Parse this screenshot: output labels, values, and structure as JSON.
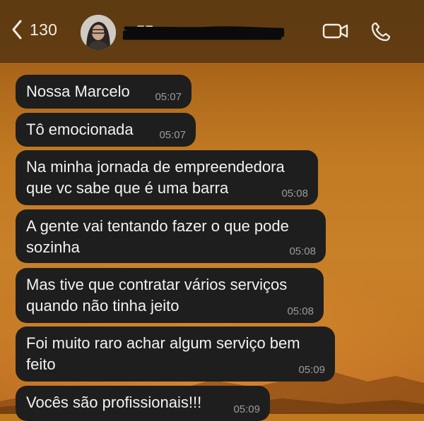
{
  "header": {
    "back_count": "130",
    "contact_name": "+55",
    "icons": {
      "back": "chevron-left-icon",
      "video": "video-camera-icon",
      "call": "phone-icon"
    }
  },
  "messages": [
    {
      "text": "Nossa Marcelo",
      "time": "05:07"
    },
    {
      "text": "Tô emocionada",
      "time": "05:07"
    },
    {
      "text": "Na minha jornada de empreendedora\nque vc sabe que é uma barra",
      "time": "05:08"
    },
    {
      "text": "A gente vai tentando fazer o que pode\nsozinha",
      "time": "05:08"
    },
    {
      "text": "Mas tive que contratar vários serviços\nquando não tinha jeito",
      "time": "05:08"
    },
    {
      "text": "Foi muito raro achar algum serviço bem\nfeito",
      "time": "05:09"
    },
    {
      "text": "Vocês são profissionais!!!",
      "time": "05:09"
    }
  ]
}
